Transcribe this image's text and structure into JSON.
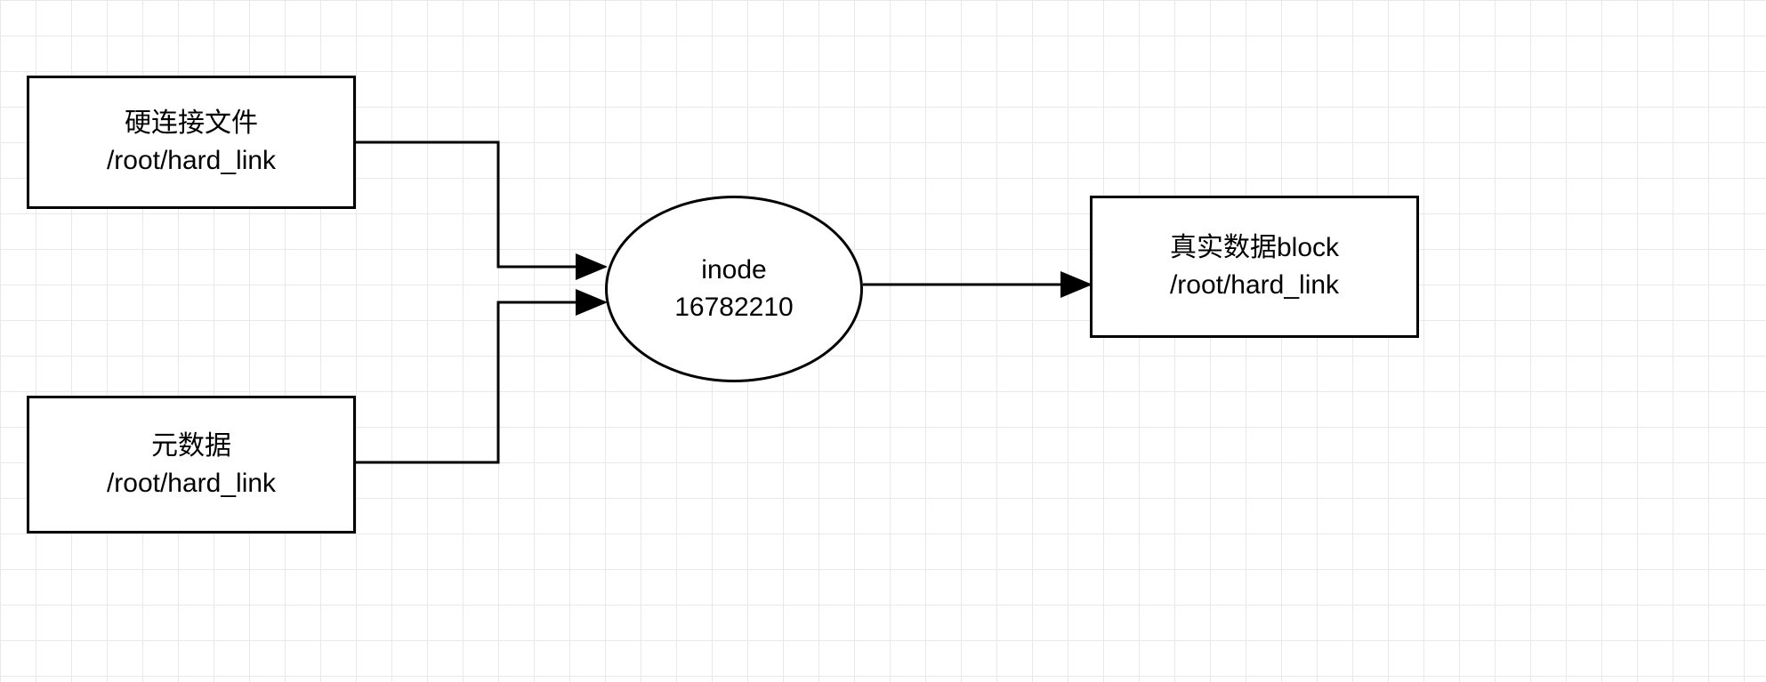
{
  "nodes": {
    "hardlink_file": {
      "line1": "硬连接文件",
      "line2": "/root/hard_link"
    },
    "metadata": {
      "line1": "元数据",
      "line2": "/root/hard_link"
    },
    "inode": {
      "line1": "inode",
      "line2": "16782210"
    },
    "datablock": {
      "line1": "真实数据block",
      "line2": "/root/hard_link"
    }
  }
}
